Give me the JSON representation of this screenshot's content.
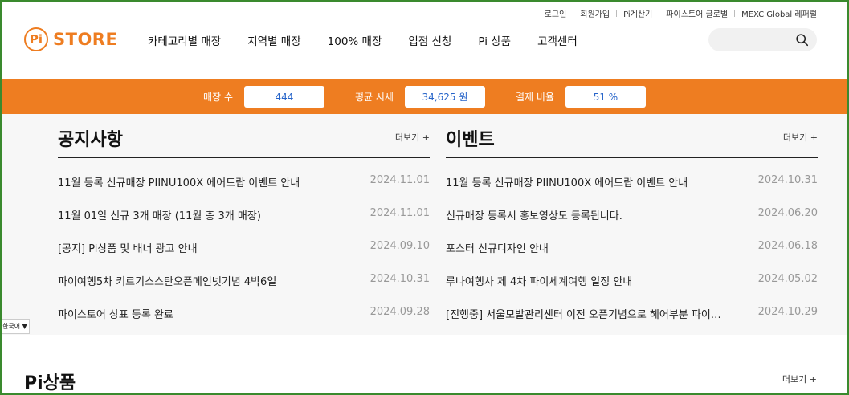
{
  "util_links": [
    "로그인",
    "회원가입",
    "Pi계산기",
    "파이스토어 글로벌",
    "MEXC Global 레퍼럴"
  ],
  "logo": {
    "mark": "Pi",
    "word": "STORE"
  },
  "nav": [
    "카테고리별 매장",
    "지역별 매장",
    "100% 매장",
    "입점 신청",
    "Pi 상품",
    "고객센터"
  ],
  "search": {
    "placeholder": ""
  },
  "stats": [
    {
      "label": "매장 수",
      "value": "444"
    },
    {
      "label": "평균 시세",
      "value": "34,625 원"
    },
    {
      "label": "결제 비율",
      "value": "51 %"
    }
  ],
  "notice": {
    "title": "공지사항",
    "more": "더보기 +",
    "items": [
      {
        "title": "11월 등록 신규매장 PIINU100X 에어드랍 이벤트 안내",
        "date": "2024.11.01"
      },
      {
        "title": "11월 01일 신규 3개 매장 (11월 총 3개 매장)",
        "date": "2024.11.01"
      },
      {
        "title": "[공지] Pi상품 및 배너 광고 안내",
        "date": "2024.09.10"
      },
      {
        "title": "파이여행5차 키르기스스탄오픈메인넷기념 4박6일",
        "date": "2024.10.31"
      },
      {
        "title": "파이스토어 상표 등록 완료",
        "date": "2024.09.28"
      }
    ]
  },
  "event": {
    "title": "이벤트",
    "more": "더보기 +",
    "items": [
      {
        "title": "11월 등록 신규매장 PIINU100X 에어드랍 이벤트 안내",
        "date": "2024.10.31"
      },
      {
        "title": "신규매장 등록시 홍보영상도 등록됩니다.",
        "date": "2024.06.20"
      },
      {
        "title": "포스터 신규디자인 안내",
        "date": "2024.06.18"
      },
      {
        "title": "루나여행사 제 4차 파이세계여행 일정 안내",
        "date": "2024.05.02"
      },
      {
        "title": "[진행중] 서울모발관리센터 이전 오픈기념으로 헤어부분 파이…",
        "date": "2024.10.29"
      }
    ]
  },
  "language": "한국어 ▼",
  "pi_section": {
    "title": "Pi상품",
    "more": "더보기 +"
  },
  "colors": {
    "accent": "#ee7d21",
    "value_text": "#2563c9",
    "frame": "#3a8a2e"
  }
}
